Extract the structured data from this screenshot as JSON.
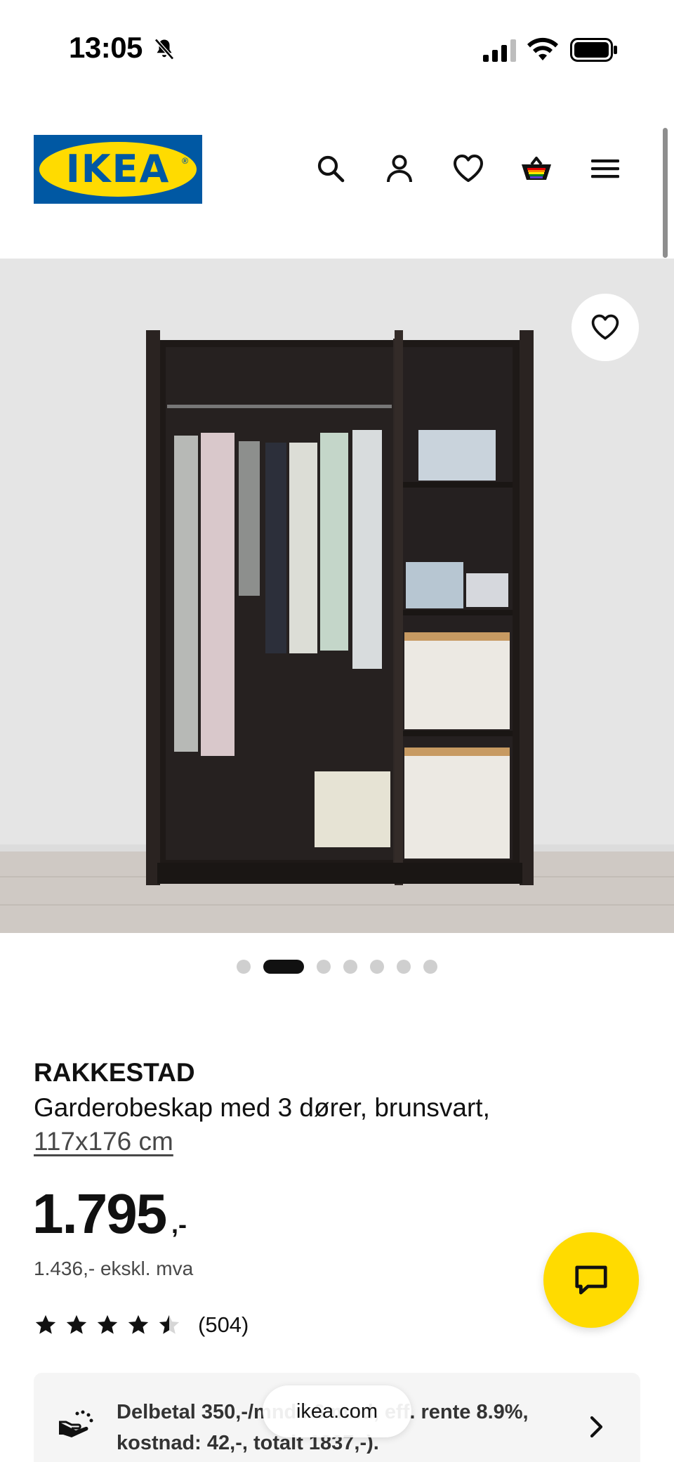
{
  "status_bar": {
    "time": "13:05",
    "icons": [
      "bell-slash-icon",
      "signal-icon",
      "wifi-icon",
      "battery-icon"
    ]
  },
  "header": {
    "logo": "IKEA",
    "icons": [
      "search-icon",
      "account-icon",
      "heart-icon",
      "cart-icon",
      "menu-icon"
    ]
  },
  "gallery": {
    "image": "RAKKESTAD wardrobe with 3 doors, black-brown, open with clothes",
    "dot_count": 7,
    "active_dot": 1
  },
  "product": {
    "name": "RAKKESTAD",
    "description": "Garderobeskap med 3 dører, brunsvart,",
    "size": "117x176 cm",
    "price": "1.795",
    "price_suffix": ",-",
    "price_ex_vat": "1.436,- ekskl. mva",
    "rating": 4.5,
    "review_count": "(504)"
  },
  "financing": {
    "text": "Delbetal 350,-/mnd i 6 mnd, eff. rente 8.9%, kostnad: 42,-, totalt 1837,-)."
  },
  "browser": {
    "url": "ikea.com"
  },
  "colors": {
    "ikea_blue": "#0058a3",
    "ikea_yellow": "#ffdb00"
  }
}
